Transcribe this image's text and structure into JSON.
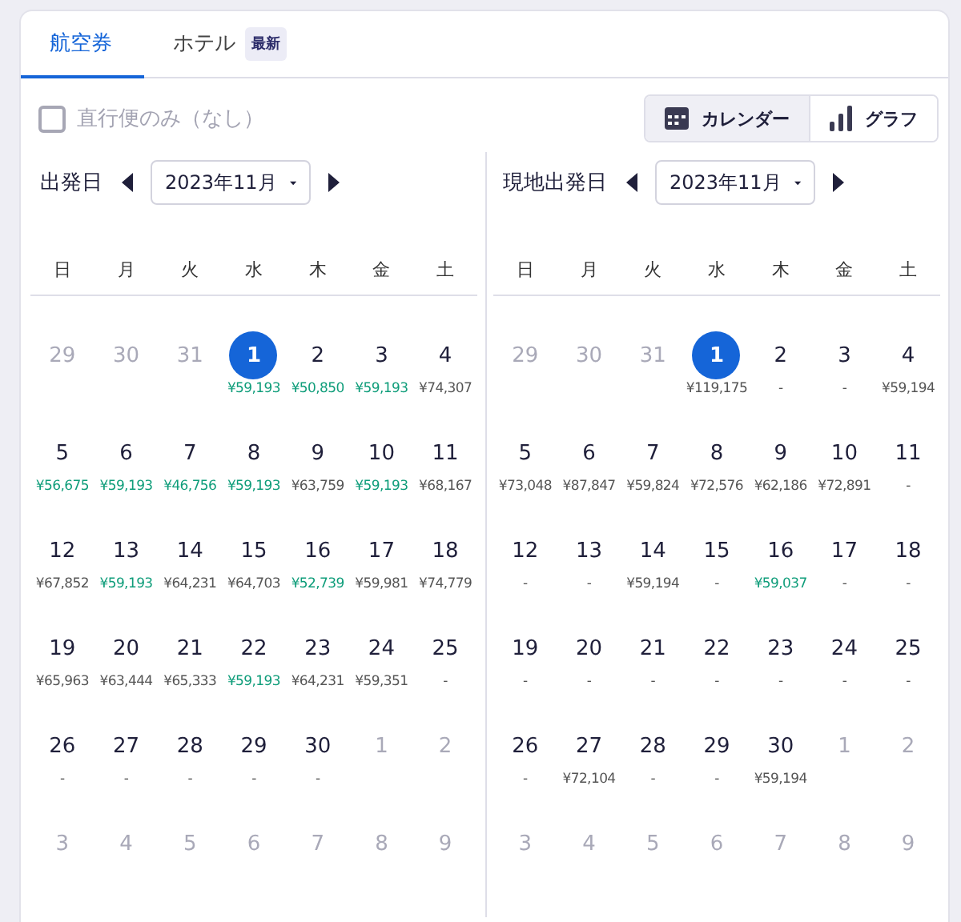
{
  "tabs": [
    {
      "label": "航空券",
      "selected": true
    },
    {
      "label": "ホテル",
      "badge": "最新",
      "selected": false
    }
  ],
  "direct_only": {
    "label": "直行便のみ（なし）",
    "checked": false
  },
  "view_toggle": [
    {
      "label": "カレンダー",
      "kind": "calendar",
      "selected": true
    },
    {
      "label": "グラフ",
      "kind": "chart",
      "selected": false
    }
  ],
  "calendars": [
    {
      "title": "出発日",
      "month": "2023年11月",
      "weekdays": [
        "日",
        "月",
        "火",
        "水",
        "木",
        "金",
        "土"
      ],
      "weeks": [
        [
          {
            "day": "29",
            "kind": "outside"
          },
          {
            "day": "30",
            "kind": "outside"
          },
          {
            "day": "31",
            "kind": "outside"
          },
          {
            "day": "1",
            "kind": "day",
            "selected": true,
            "price": "¥59,193",
            "cheap": true
          },
          {
            "day": "2",
            "kind": "day",
            "selected": false,
            "price": "¥50,850",
            "cheap": true
          },
          {
            "day": "3",
            "kind": "day",
            "selected": false,
            "price": "¥59,193",
            "cheap": true
          },
          {
            "day": "4",
            "kind": "day",
            "selected": false,
            "price": "¥74,307",
            "cheap": false
          }
        ],
        [
          {
            "day": "5",
            "kind": "day",
            "selected": false,
            "price": "¥56,675",
            "cheap": true
          },
          {
            "day": "6",
            "kind": "day",
            "selected": false,
            "price": "¥59,193",
            "cheap": true
          },
          {
            "day": "7",
            "kind": "day",
            "selected": false,
            "price": "¥46,756",
            "cheap": true
          },
          {
            "day": "8",
            "kind": "day",
            "selected": false,
            "price": "¥59,193",
            "cheap": true
          },
          {
            "day": "9",
            "kind": "day",
            "selected": false,
            "price": "¥63,759",
            "cheap": false
          },
          {
            "day": "10",
            "kind": "day",
            "selected": false,
            "price": "¥59,193",
            "cheap": true
          },
          {
            "day": "11",
            "kind": "day",
            "selected": false,
            "price": "¥68,167",
            "cheap": false
          }
        ],
        [
          {
            "day": "12",
            "kind": "day",
            "selected": false,
            "price": "¥67,852",
            "cheap": false
          },
          {
            "day": "13",
            "kind": "day",
            "selected": false,
            "price": "¥59,193",
            "cheap": true
          },
          {
            "day": "14",
            "kind": "day",
            "selected": false,
            "price": "¥64,231",
            "cheap": false
          },
          {
            "day": "15",
            "kind": "day",
            "selected": false,
            "price": "¥64,703",
            "cheap": false
          },
          {
            "day": "16",
            "kind": "day",
            "selected": false,
            "price": "¥52,739",
            "cheap": true
          },
          {
            "day": "17",
            "kind": "day",
            "selected": false,
            "price": "¥59,981",
            "cheap": false
          },
          {
            "day": "18",
            "kind": "day",
            "selected": false,
            "price": "¥74,779",
            "cheap": false
          }
        ],
        [
          {
            "day": "19",
            "kind": "day",
            "selected": false,
            "price": "¥65,963",
            "cheap": false
          },
          {
            "day": "20",
            "kind": "day",
            "selected": false,
            "price": "¥63,444",
            "cheap": false
          },
          {
            "day": "21",
            "kind": "day",
            "selected": false,
            "price": "¥65,333",
            "cheap": false
          },
          {
            "day": "22",
            "kind": "day",
            "selected": false,
            "price": "¥59,193",
            "cheap": true
          },
          {
            "day": "23",
            "kind": "day",
            "selected": false,
            "price": "¥64,231",
            "cheap": false
          },
          {
            "day": "24",
            "kind": "day",
            "selected": false,
            "price": "¥59,351",
            "cheap": false
          },
          {
            "day": "25",
            "kind": "day",
            "selected": false,
            "price": "-",
            "cheap": false
          }
        ],
        [
          {
            "day": "26",
            "kind": "day",
            "selected": false,
            "price": "-",
            "cheap": false
          },
          {
            "day": "27",
            "kind": "day",
            "selected": false,
            "price": "-",
            "cheap": false
          },
          {
            "day": "28",
            "kind": "day",
            "selected": false,
            "price": "-",
            "cheap": false
          },
          {
            "day": "29",
            "kind": "day",
            "selected": false,
            "price": "-",
            "cheap": false
          },
          {
            "day": "30",
            "kind": "day",
            "selected": false,
            "price": "-",
            "cheap": false
          },
          {
            "day": "1",
            "kind": "outside"
          },
          {
            "day": "2",
            "kind": "outside"
          }
        ],
        [
          {
            "day": "3",
            "kind": "outside"
          },
          {
            "day": "4",
            "kind": "outside"
          },
          {
            "day": "5",
            "kind": "outside"
          },
          {
            "day": "6",
            "kind": "outside"
          },
          {
            "day": "7",
            "kind": "outside"
          },
          {
            "day": "8",
            "kind": "outside"
          },
          {
            "day": "9",
            "kind": "outside"
          }
        ]
      ]
    },
    {
      "title": "現地出発日",
      "month": "2023年11月",
      "weekdays": [
        "日",
        "月",
        "火",
        "水",
        "木",
        "金",
        "土"
      ],
      "weeks": [
        [
          {
            "day": "29",
            "kind": "outside"
          },
          {
            "day": "30",
            "kind": "outside"
          },
          {
            "day": "31",
            "kind": "outside"
          },
          {
            "day": "1",
            "kind": "day",
            "selected": true,
            "price": "¥119,175",
            "cheap": false
          },
          {
            "day": "2",
            "kind": "day",
            "selected": false,
            "price": "-",
            "cheap": false
          },
          {
            "day": "3",
            "kind": "day",
            "selected": false,
            "price": "-",
            "cheap": false
          },
          {
            "day": "4",
            "kind": "day",
            "selected": false,
            "price": "¥59,194",
            "cheap": false
          }
        ],
        [
          {
            "day": "5",
            "kind": "day",
            "selected": false,
            "price": "¥73,048",
            "cheap": false
          },
          {
            "day": "6",
            "kind": "day",
            "selected": false,
            "price": "¥87,847",
            "cheap": false
          },
          {
            "day": "7",
            "kind": "day",
            "selected": false,
            "price": "¥59,824",
            "cheap": false
          },
          {
            "day": "8",
            "kind": "day",
            "selected": false,
            "price": "¥72,576",
            "cheap": false
          },
          {
            "day": "9",
            "kind": "day",
            "selected": false,
            "price": "¥62,186",
            "cheap": false
          },
          {
            "day": "10",
            "kind": "day",
            "selected": false,
            "price": "¥72,891",
            "cheap": false
          },
          {
            "day": "11",
            "kind": "day",
            "selected": false,
            "price": "-",
            "cheap": false
          }
        ],
        [
          {
            "day": "12",
            "kind": "day",
            "selected": false,
            "price": "-",
            "cheap": false
          },
          {
            "day": "13",
            "kind": "day",
            "selected": false,
            "price": "-",
            "cheap": false
          },
          {
            "day": "14",
            "kind": "day",
            "selected": false,
            "price": "¥59,194",
            "cheap": false
          },
          {
            "day": "15",
            "kind": "day",
            "selected": false,
            "price": "-",
            "cheap": false
          },
          {
            "day": "16",
            "kind": "day",
            "selected": false,
            "price": "¥59,037",
            "cheap": true
          },
          {
            "day": "17",
            "kind": "day",
            "selected": false,
            "price": "-",
            "cheap": false
          },
          {
            "day": "18",
            "kind": "day",
            "selected": false,
            "price": "-",
            "cheap": false
          }
        ],
        [
          {
            "day": "19",
            "kind": "day",
            "selected": false,
            "price": "-",
            "cheap": false
          },
          {
            "day": "20",
            "kind": "day",
            "selected": false,
            "price": "-",
            "cheap": false
          },
          {
            "day": "21",
            "kind": "day",
            "selected": false,
            "price": "-",
            "cheap": false
          },
          {
            "day": "22",
            "kind": "day",
            "selected": false,
            "price": "-",
            "cheap": false
          },
          {
            "day": "23",
            "kind": "day",
            "selected": false,
            "price": "-",
            "cheap": false
          },
          {
            "day": "24",
            "kind": "day",
            "selected": false,
            "price": "-",
            "cheap": false
          },
          {
            "day": "25",
            "kind": "day",
            "selected": false,
            "price": "-",
            "cheap": false
          }
        ],
        [
          {
            "day": "26",
            "kind": "day",
            "selected": false,
            "price": "-",
            "cheap": false
          },
          {
            "day": "27",
            "kind": "day",
            "selected": false,
            "price": "¥72,104",
            "cheap": false
          },
          {
            "day": "28",
            "kind": "day",
            "selected": false,
            "price": "-",
            "cheap": false
          },
          {
            "day": "29",
            "kind": "day",
            "selected": false,
            "price": "-",
            "cheap": false
          },
          {
            "day": "30",
            "kind": "day",
            "selected": false,
            "price": "¥59,194",
            "cheap": false
          },
          {
            "day": "1",
            "kind": "outside"
          },
          {
            "day": "2",
            "kind": "outside"
          }
        ],
        [
          {
            "day": "3",
            "kind": "outside"
          },
          {
            "day": "4",
            "kind": "outside"
          },
          {
            "day": "5",
            "kind": "outside"
          },
          {
            "day": "6",
            "kind": "outside"
          },
          {
            "day": "7",
            "kind": "outside"
          },
          {
            "day": "8",
            "kind": "outside"
          },
          {
            "day": "9",
            "kind": "outside"
          }
        ]
      ]
    }
  ]
}
